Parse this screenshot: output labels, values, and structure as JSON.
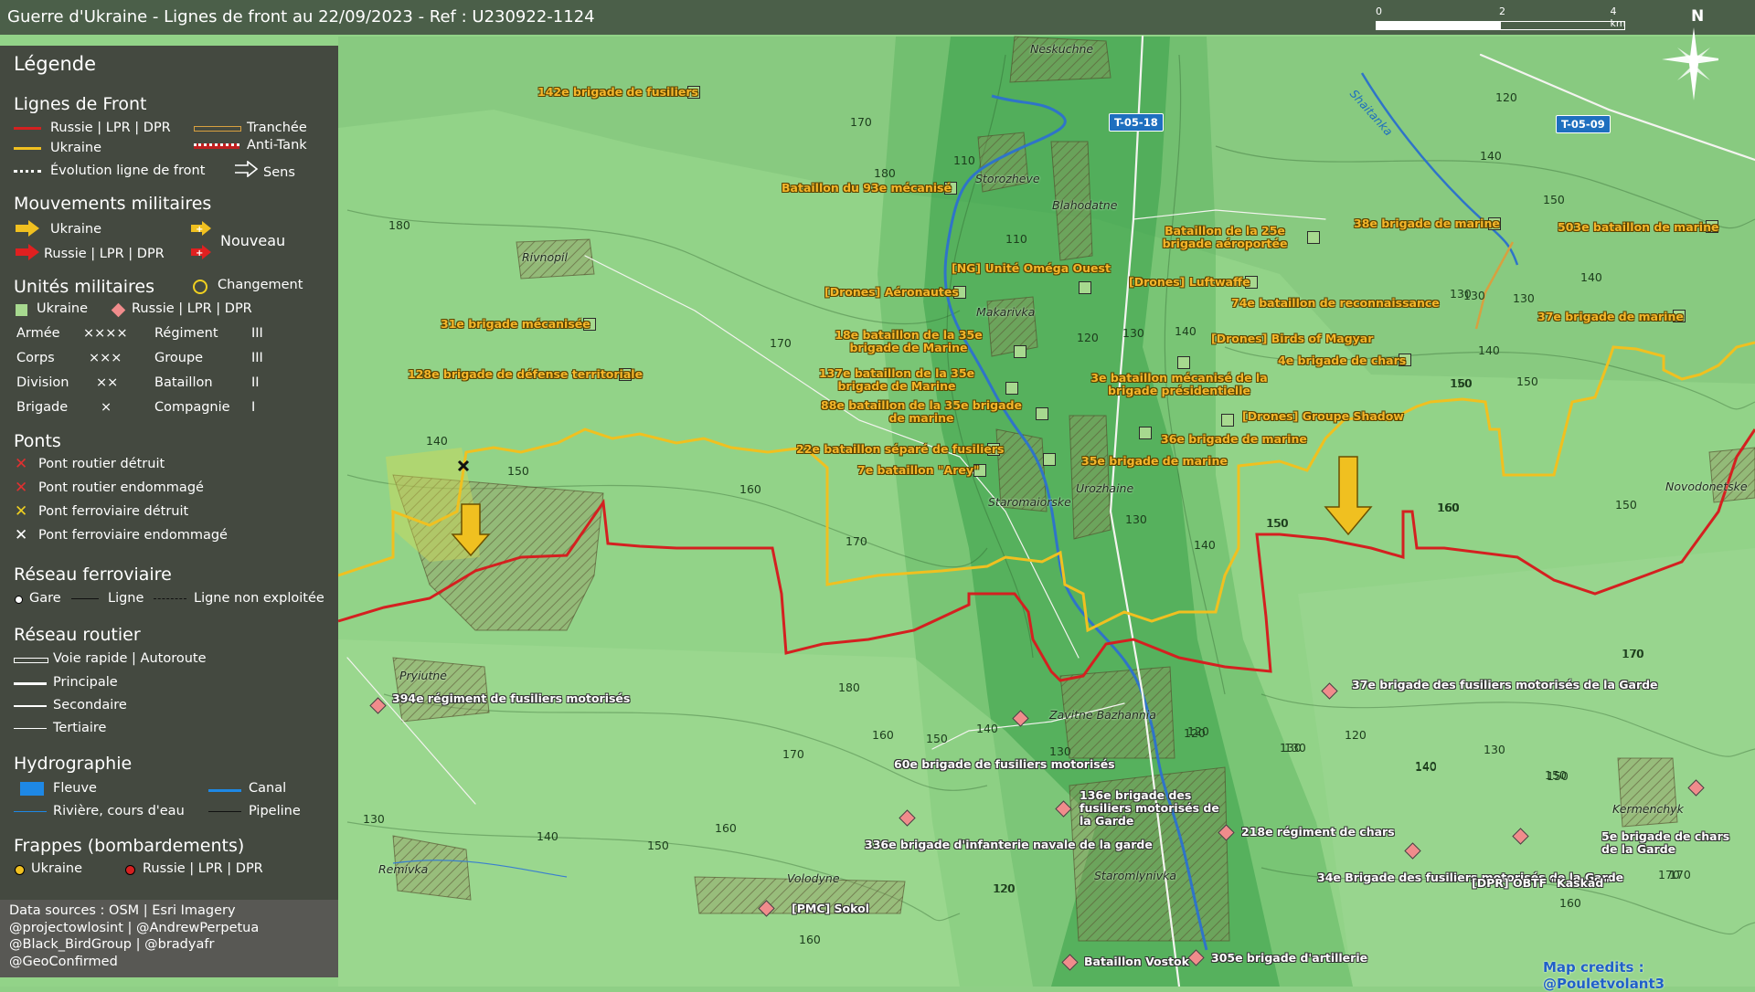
{
  "title": "Guerre d'Ukraine - Lignes de front au 22/09/2023 - Ref : U230922-1124",
  "scale": {
    "ticks": [
      "0",
      "2",
      "4 km"
    ]
  },
  "north": "N",
  "colors": {
    "russia": "#d42020",
    "ukraine": "#f0c020",
    "ua_label": "#f5b62a"
  },
  "legend": {
    "title": "Légende",
    "frontlines": {
      "title": "Lignes de Front",
      "russia": "Russie | LPR | DPR",
      "ukraine": "Ukraine",
      "evolution": "Évolution ligne de front",
      "trench": "Tranchée",
      "antitank": "Anti-Tank",
      "direction": "Sens"
    },
    "movements": {
      "title": "Mouvements militaires",
      "ukraine": "Ukraine",
      "russia": "Russie | LPR | DPR",
      "new": "Nouveau"
    },
    "units": {
      "title": "Unités militaires",
      "change": "Changement",
      "ukraine": "Ukraine",
      "russia": "Russie | LPR | DPR",
      "army": "Armée",
      "army_sym": "××××",
      "corps": "Corps",
      "corps_sym": "×××",
      "division": "Division",
      "division_sym": "××",
      "brigade": "Brigade",
      "brigade_sym": "×",
      "regiment": "Régiment",
      "regiment_sym": "III",
      "group": "Groupe",
      "group_sym": "III",
      "battalion": "Bataillon",
      "battalion_sym": "II",
      "company": "Compagnie",
      "company_sym": "I"
    },
    "bridges": {
      "title": "Ponts",
      "items": [
        "Pont routier détruit",
        "Pont routier endommagé",
        "Pont ferroviaire détruit",
        "Pont ferroviaire endommagé"
      ]
    },
    "rail": {
      "title": "Réseau ferroviaire",
      "station": "Gare",
      "line": "Ligne",
      "unused": "Ligne non exploitée"
    },
    "roads": {
      "title": "Réseau routier",
      "items": [
        "Voie rapide | Autoroute",
        "Principale",
        "Secondaire",
        "Tertiaire"
      ]
    },
    "hydro": {
      "title": "Hydrographie",
      "river_big": "Fleuve",
      "canal": "Canal",
      "river": "Rivière, cours d'eau",
      "pipeline": "Pipeline"
    },
    "strikes": {
      "title": "Frappes (bombardements)",
      "ukraine": "Ukraine",
      "russia": "Russie | LPR | DPR"
    }
  },
  "credits": [
    "Data sources : OSM | Esri Imagery",
    "@projectowlosint | @AndrewPerpetua",
    "@Black_BirdGroup | @bradyafr",
    "@GeoConfirmed"
  ],
  "map_credit": "Map credits : @Pouletvolant3",
  "places": [
    "Neskuchne",
    "Storozheve",
    "Blahodatne",
    "Rivnopil",
    "Makarivka",
    "Urozhaine",
    "Staromaiorske",
    "Novodonetske",
    "Pryiutne",
    "Zavitne Bazhannia",
    "Staromlynivka",
    "Kermenchyk",
    "Remivka",
    "Volodyne"
  ],
  "river": "Shaitanka",
  "roads": [
    "T-05-18",
    "T-05-09"
  ],
  "ukraine_units": [
    "142e brigade de fusiliers",
    "Bataillon du 93e mécanisé",
    "[NG] Unité Oméga Ouest",
    "[Drones] Aéronautes",
    "31e brigade mécanisée",
    "128e brigade de défense territoriale",
    "18e bataillon de la 35e brigade de Marine",
    "137e bataillon de la 35e brigade de Marine",
    "88e bataillon de la 35e brigade de marine",
    "22e bataillon séparé de fusiliers",
    "7e bataillon \"Arey\"",
    "35e brigade de marine",
    "Bataillon de la 25e brigade aéroportée",
    "38e brigade de marine",
    "503e bataillon de marine",
    "[Drones] Luftwaffe",
    "74e bataillon de reconnaissance",
    "37e brigade de marine",
    "[Drones] Birds of Magyar",
    "4e brigade de chars",
    "3e bataillon mécanisé de la brigade présidentielle",
    "[Drones] Groupe Shadow",
    "36e brigade de marine"
  ],
  "russia_units": [
    "394e régiment de fusiliers motorisés",
    "60e brigade de fusiliers motorisés",
    "336e brigade d'infanterie navale de la garde",
    "[PMC] Sokol",
    "136e brigade des fusiliers motorisés de la Garde",
    "218e régiment de chars",
    "37e brigade des fusiliers motorisés de la Garde",
    "34e Brigade des fusiliers motorisés de la Garde",
    "[DPR] OBTF \"Kaskad\"",
    "5e brigade de chars de la Garde",
    "Bataillon Vostok",
    "305e brigade d'artillerie"
  ],
  "contours": [
    "170",
    "180",
    "110",
    "110",
    "180",
    "170",
    "120",
    "130",
    "140",
    "140",
    "150",
    "160",
    "170",
    "130",
    "140",
    "150",
    "160",
    "130",
    "140",
    "150",
    "120",
    "130",
    "140",
    "150",
    "160",
    "170",
    "130",
    "140",
    "150",
    "160",
    "170",
    "120",
    "140",
    "130",
    "140",
    "150",
    "170",
    "160",
    "120",
    "130",
    "150",
    "130",
    "150",
    "120",
    "180",
    "160",
    "170",
    "150",
    "130",
    "140",
    "150",
    "160",
    "120",
    "160",
    "130",
    "140",
    "150",
    "160",
    "170",
    "120"
  ]
}
